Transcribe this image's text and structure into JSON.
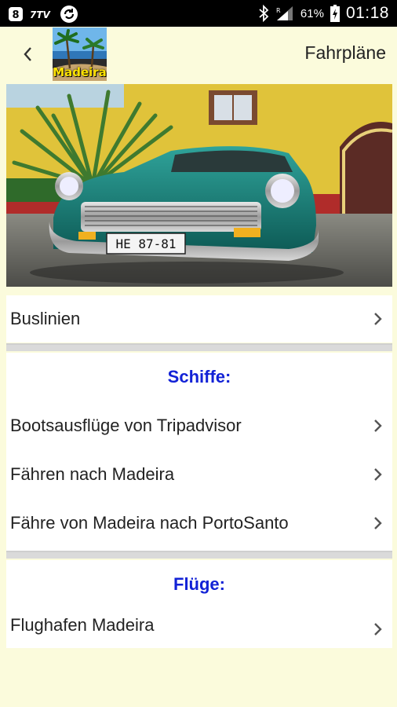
{
  "status_bar": {
    "network_label": "7TV",
    "battery_percent": "61%",
    "time": "01:18",
    "icons": [
      "notification-icon",
      "sync-icon",
      "bluetooth-icon",
      "signal-icon",
      "battery-charging-icon"
    ]
  },
  "app_bar": {
    "logo_text": "Madeira",
    "title": "Fahrpläne"
  },
  "hero": {
    "license_plate": "HE 87-81"
  },
  "menu": {
    "buslinien": "Buslinien",
    "schiffe_heading": "Schiffe:",
    "schiffe_items": [
      "Bootsausflüge von Tripadvisor",
      "Fähren nach Madeira",
      "Fähre von Madeira nach PortoSanto"
    ],
    "fluege_heading": "Flüge:",
    "fluege_items": [
      "Flughafen Madeira"
    ]
  },
  "colors": {
    "background": "#fbfbdc",
    "section_heading": "#1222d6",
    "status_bar": "#000000"
  }
}
